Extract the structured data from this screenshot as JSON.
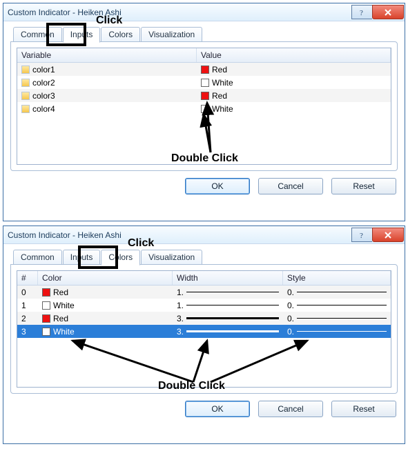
{
  "dialog1": {
    "title": "Custom Indicator - Heiken Ashi",
    "tabs": {
      "common": "Common",
      "inputs": "Inputs",
      "colors": "Colors",
      "visualization": "Visualization"
    },
    "headers": {
      "variable": "Variable",
      "value": "Value"
    },
    "rows": [
      {
        "name": "color1",
        "color_name": "Red",
        "color_hex": "#e11"
      },
      {
        "name": "color2",
        "color_name": "White",
        "color_hex": "#fff"
      },
      {
        "name": "color3",
        "color_name": "Red",
        "color_hex": "#e11"
      },
      {
        "name": "color4",
        "color_name": "White",
        "color_hex": "#fff"
      }
    ],
    "buttons": {
      "ok": "OK",
      "cancel": "Cancel",
      "reset": "Reset"
    }
  },
  "dialog2": {
    "title": "Custom Indicator - Heiken Ashi",
    "tabs": {
      "common": "Common",
      "inputs": "Inputs",
      "colors": "Colors",
      "visualization": "Visualization"
    },
    "headers": {
      "idx": "#",
      "color": "Color",
      "width": "Width",
      "style": "Style"
    },
    "rows": [
      {
        "idx": "0",
        "color_name": "Red",
        "color_hex": "#e11",
        "width": "1.",
        "style": "0."
      },
      {
        "idx": "1",
        "color_name": "White",
        "color_hex": "#fff",
        "width": "1.",
        "style": "0."
      },
      {
        "idx": "2",
        "color_name": "Red",
        "color_hex": "#e11",
        "width": "3.",
        "style": "0."
      },
      {
        "idx": "3",
        "color_name": "White",
        "color_hex": "#fff",
        "width": "3.",
        "style": "0."
      }
    ],
    "buttons": {
      "ok": "OK",
      "cancel": "Cancel",
      "reset": "Reset"
    }
  },
  "annotations": {
    "click": "Click",
    "double_click": "Double Click"
  }
}
